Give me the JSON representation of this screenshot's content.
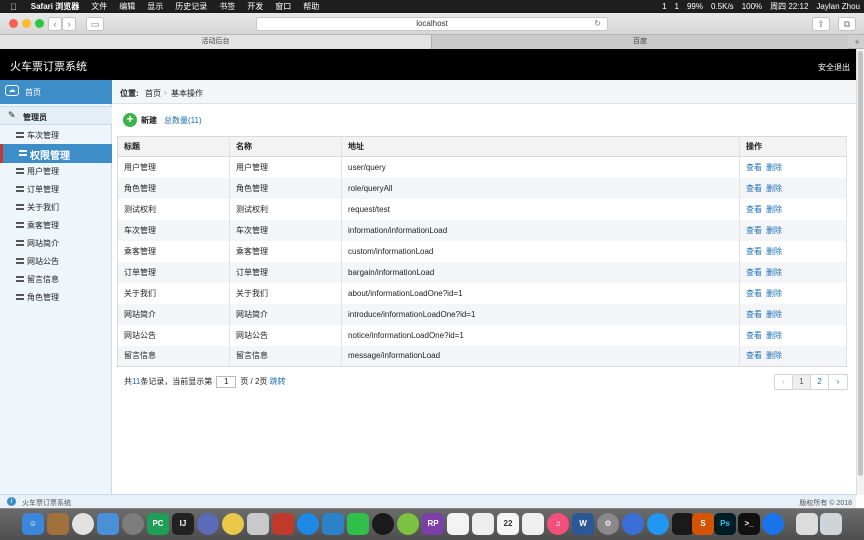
{
  "menubar": {
    "apple": "",
    "app": "Safari 浏览器",
    "items": [
      "文件",
      "编辑",
      "显示",
      "历史记录",
      "书签",
      "开发",
      "窗口",
      "帮助"
    ],
    "status": [
      "1",
      "1",
      "99%",
      "0.5K/s",
      "100%",
      "周四 22:12",
      "Jaylan Zhou"
    ]
  },
  "browser": {
    "url": "localhost",
    "tabs": [
      "活动后台",
      "百度"
    ],
    "new_tab": "+"
  },
  "app": {
    "title": "火车票订票系统",
    "logout": "安全退出"
  },
  "sidebar": {
    "home": "首页",
    "group": "管理员",
    "items": [
      {
        "label": "车次管理",
        "active": false
      },
      {
        "label": "权限管理",
        "active": true
      },
      {
        "label": "用户管理",
        "active": false
      },
      {
        "label": "订单管理",
        "active": false
      },
      {
        "label": "关于我们",
        "active": false
      },
      {
        "label": "乘客管理",
        "active": false
      },
      {
        "label": "网站简介",
        "active": false
      },
      {
        "label": "网站公告",
        "active": false
      },
      {
        "label": "留言信息",
        "active": false
      },
      {
        "label": "角色管理",
        "active": false
      }
    ]
  },
  "breadcrumb": {
    "lead": "位置:",
    "home": "首页",
    "sep": "›",
    "current": "基本操作"
  },
  "actions": {
    "add": "新建",
    "total": "总数量(11)"
  },
  "table": {
    "headers": [
      "标题",
      "名称",
      "地址",
      "操作"
    ],
    "view": "查看",
    "delete": "删除",
    "rows": [
      [
        "用户管理",
        "用户管理",
        "user/query"
      ],
      [
        "角色管理",
        "角色管理",
        "role/queryAll"
      ],
      [
        "测试权利",
        "测试权利",
        "request/test"
      ],
      [
        "车次管理",
        "车次管理",
        "information/informationLoad"
      ],
      [
        "乘客管理",
        "乘客管理",
        "custom/informationLoad"
      ],
      [
        "订单管理",
        "订单管理",
        "bargain/informationLoad"
      ],
      [
        "关于我们",
        "关于我们",
        "about/informationLoadOne?id=1"
      ],
      [
        "网站简介",
        "网站简介",
        "introduce/informationLoadOne?id=1"
      ],
      [
        "网站公告",
        "网站公告",
        "notice/informationLoadOne?id=1"
      ],
      [
        "留言信息",
        "留言信息",
        "message/informationLoad"
      ]
    ]
  },
  "pager": {
    "prefix": "共",
    "count": "11",
    "mid": "条记录，当前显示第",
    "page": "1",
    "of": "页 / 2页",
    "jump": "跳转",
    "prev": "‹",
    "pages": [
      "1",
      "2"
    ],
    "next": "›"
  },
  "footer": {
    "name": "火车票订票系统",
    "copyright": "版权所有 © 2018"
  },
  "colors": {
    "accent": "#3d8dc9",
    "link": "#1b6fb8",
    "header_bg": "#000000"
  }
}
